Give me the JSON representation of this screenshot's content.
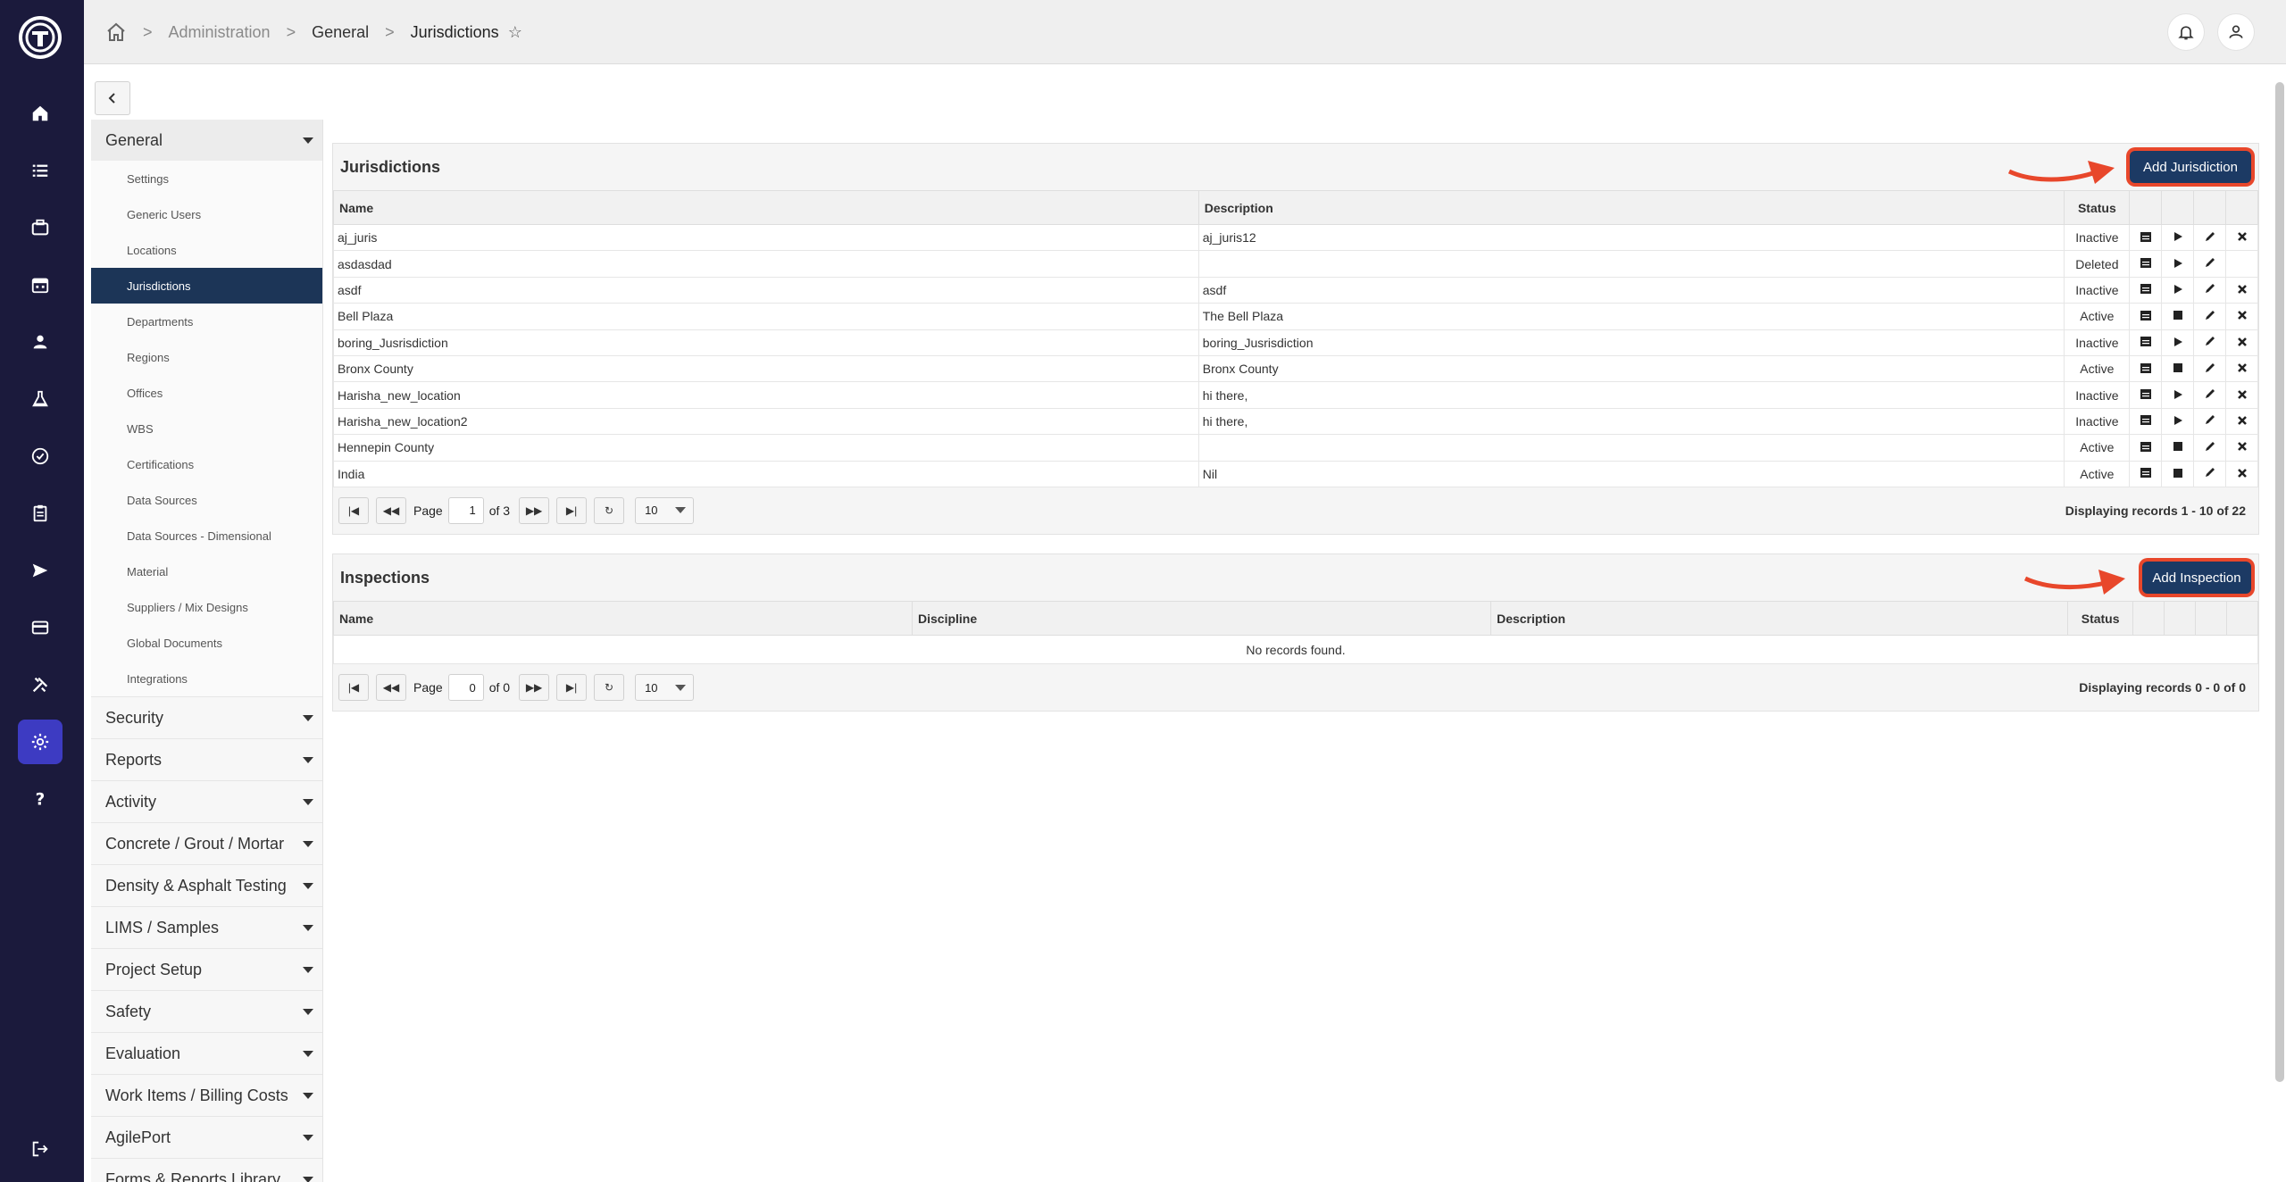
{
  "breadcrumb": {
    "items": [
      "Administration",
      "General",
      "Jurisdictions"
    ]
  },
  "sidebar": {
    "open_group": "General",
    "sub_items": [
      "Settings",
      "Generic Users",
      "Locations",
      "Jurisdictions",
      "Departments",
      "Regions",
      "Offices",
      "WBS",
      "Certifications",
      "Data Sources",
      "Data Sources - Dimensional",
      "Material",
      "Suppliers / Mix Designs",
      "Global Documents",
      "Integrations"
    ],
    "active_sub": "Jurisdictions",
    "groups": [
      "Security",
      "Reports",
      "Activity",
      "Concrete / Grout / Mortar",
      "Density & Asphalt Testing",
      "LIMS / Samples",
      "Project Setup",
      "Safety",
      "Evaluation",
      "Work Items / Billing Costs",
      "AgilePort",
      "Forms & Reports Library"
    ]
  },
  "jurisdictions": {
    "title": "Jurisdictions",
    "add_label": "Add Jurisdiction",
    "columns": [
      "Name",
      "Description",
      "Status"
    ],
    "rows": [
      {
        "name": "aj_juris",
        "description": "aj_juris12",
        "status": "Inactive",
        "play": "play",
        "del": true
      },
      {
        "name": "asdasdad",
        "description": "",
        "status": "Deleted",
        "play": "play",
        "del": false
      },
      {
        "name": "asdf",
        "description": "asdf",
        "status": "Inactive",
        "play": "play",
        "del": true
      },
      {
        "name": "Bell Plaza",
        "description": "The Bell Plaza",
        "status": "Active",
        "play": "stop",
        "del": true
      },
      {
        "name": "boring_Jusrisdiction",
        "description": "boring_Jusrisdiction",
        "status": "Inactive",
        "play": "play",
        "del": true
      },
      {
        "name": "Bronx County",
        "description": "Bronx County",
        "status": "Active",
        "play": "stop",
        "del": true
      },
      {
        "name": "Harisha_new_location",
        "description": "hi there,",
        "status": "Inactive",
        "play": "play",
        "del": true
      },
      {
        "name": "Harisha_new_location2",
        "description": "hi there,",
        "status": "Inactive",
        "play": "play",
        "del": true
      },
      {
        "name": "Hennepin County",
        "description": "",
        "status": "Active",
        "play": "stop",
        "del": true
      },
      {
        "name": "India",
        "description": "Nil",
        "status": "Active",
        "play": "stop",
        "del": true
      }
    ],
    "pager": {
      "page_label": "Page",
      "page": "1",
      "of": "of 3",
      "size": "10",
      "display": "Displaying records  1 - 10  of  22"
    }
  },
  "inspections": {
    "title": "Inspections",
    "add_label": "Add Inspection",
    "columns": [
      "Name",
      "Discipline",
      "Description",
      "Status"
    ],
    "empty": "No records found.",
    "pager": {
      "page_label": "Page",
      "page": "0",
      "of": "of 0",
      "size": "10",
      "display": "Displaying records  0 - 0  of  0"
    }
  },
  "colors": {
    "rail": "#1b1a3c",
    "rail_active": "#3d3bc2",
    "sidebar_active": "#1c3557",
    "button": "#1c3a64",
    "highlight": "#e8472b"
  },
  "icons": [
    "home-icon",
    "list-icon",
    "briefcase-icon",
    "calendar-icon",
    "person-icon",
    "flask-icon",
    "badge-check-icon",
    "clipboard-icon",
    "send-icon",
    "card-icon",
    "tools-icon",
    "gear-icon",
    "help-icon",
    "logout-icon",
    "bell-icon",
    "user-icon",
    "star-icon"
  ]
}
